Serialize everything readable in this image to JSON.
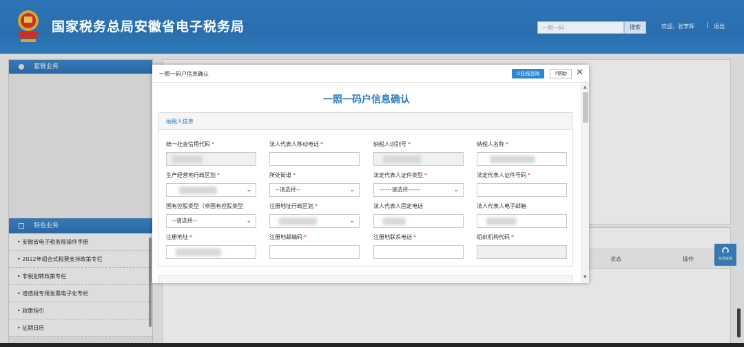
{
  "header": {
    "title": "国家税务总局安徽省电子税务局",
    "search_placeholder": "一照一码",
    "search_button": "搜索",
    "welcome": "欢迎，张李辉",
    "separator": "|",
    "logout": "退出"
  },
  "left_panel": {
    "section1_title": "套餐业务",
    "section2_title": "特色业务",
    "items": [
      "安徽省电子税务局操作手册",
      "2022年组合式税费支持政策专栏",
      "非税划转政策专栏",
      "增值税专用发票电子化专栏",
      "政策指引",
      "征期日历"
    ]
  },
  "main_bottom": {
    "col_status": "状态",
    "col_action": "操作"
  },
  "online_badge": "在线咨询",
  "modal": {
    "window_title": "一照一码户信息确认",
    "consult_button": "在线咨询",
    "help_button": "?帮助",
    "close": "✕",
    "heading": "一照一码户信息确认",
    "section_title": "纳税人信息",
    "fields": [
      {
        "label": "统一社会信用代码",
        "required": true,
        "type": "text",
        "readonly": true,
        "value": ""
      },
      {
        "label": "法人代表人移动电话",
        "required": true,
        "type": "text",
        "readonly": false,
        "value": ""
      },
      {
        "label": "纳税人识别号",
        "required": true,
        "type": "text",
        "readonly": true,
        "value": ""
      },
      {
        "label": "纳税人名称",
        "required": true,
        "type": "text",
        "readonly": false,
        "value": ""
      },
      {
        "label": "生产经营地行政区划",
        "required": true,
        "type": "select",
        "readonly": false,
        "value": ""
      },
      {
        "label": "所处街道",
        "required": true,
        "type": "select",
        "readonly": false,
        "value": "--请选择--"
      },
      {
        "label": "法定代表人证件类型",
        "required": true,
        "type": "select",
        "readonly": false,
        "value": "------请选择------"
      },
      {
        "label": "法定代表人证件号码",
        "required": true,
        "type": "text",
        "readonly": false,
        "value": ""
      },
      {
        "label": "国有控股类型（非国有控股类型",
        "required": false,
        "type": "select",
        "readonly": false,
        "value": "--请选择--"
      },
      {
        "label": "注册地址行政区划",
        "required": true,
        "type": "select",
        "readonly": false,
        "value": ""
      },
      {
        "label": "法人代表人固定电话",
        "required": false,
        "type": "text",
        "readonly": false,
        "value": ""
      },
      {
        "label": "法人代表人电子邮箱",
        "required": false,
        "type": "text",
        "readonly": false,
        "value": ""
      },
      {
        "label": "注册地址",
        "required": true,
        "type": "text",
        "readonly": false,
        "value": ""
      },
      {
        "label": "注册地邮编码",
        "required": true,
        "type": "text",
        "readonly": false,
        "value": ""
      },
      {
        "label": "注册地联系电话",
        "required": true,
        "type": "text",
        "readonly": false,
        "value": ""
      },
      {
        "label": "组织机构代码",
        "required": true,
        "type": "text",
        "readonly": true,
        "value": ""
      }
    ]
  },
  "colors": {
    "header_blue": "#2d74b5",
    "accent_blue": "#2a7ac4",
    "required_red": "#d9342b"
  }
}
